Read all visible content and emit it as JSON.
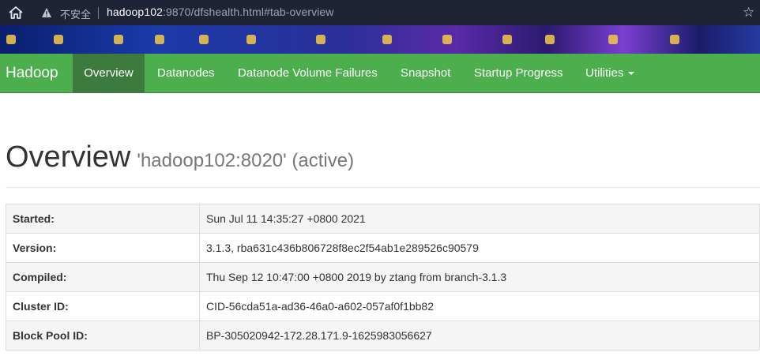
{
  "browser": {
    "security_label": "不安全",
    "url_host": "hadoop102",
    "url_rest": ":9870/dfshealth.html#tab-overview"
  },
  "navbar": {
    "brand": "Hadoop",
    "items": [
      {
        "label": "Overview",
        "active": true
      },
      {
        "label": "Datanodes"
      },
      {
        "label": "Datanode Volume Failures"
      },
      {
        "label": "Snapshot"
      },
      {
        "label": "Startup Progress"
      },
      {
        "label": "Utilities"
      }
    ]
  },
  "page": {
    "title": "Overview",
    "subtitle": "'hadoop102:8020' (active)"
  },
  "info_table": [
    {
      "key": "Started:",
      "value": "Sun Jul 11 14:35:27 +0800 2021"
    },
    {
      "key": "Version:",
      "value": "3.1.3, rba631c436b806728f8ec2f54ab1e289526c90579"
    },
    {
      "key": "Compiled:",
      "value": "Thu Sep 12 10:47:00 +0800 2019 by ztang from branch-3.1.3"
    },
    {
      "key": "Cluster ID:",
      "value": "CID-56cda51a-ad36-46a0-a602-057af0f1bb82"
    },
    {
      "key": "Block Pool ID:",
      "value": "BP-305020942-172.28.171.9-1625983056627"
    }
  ],
  "colors": {
    "navbar": "#4cae4c",
    "navbar_active": "#3d7a3d"
  }
}
